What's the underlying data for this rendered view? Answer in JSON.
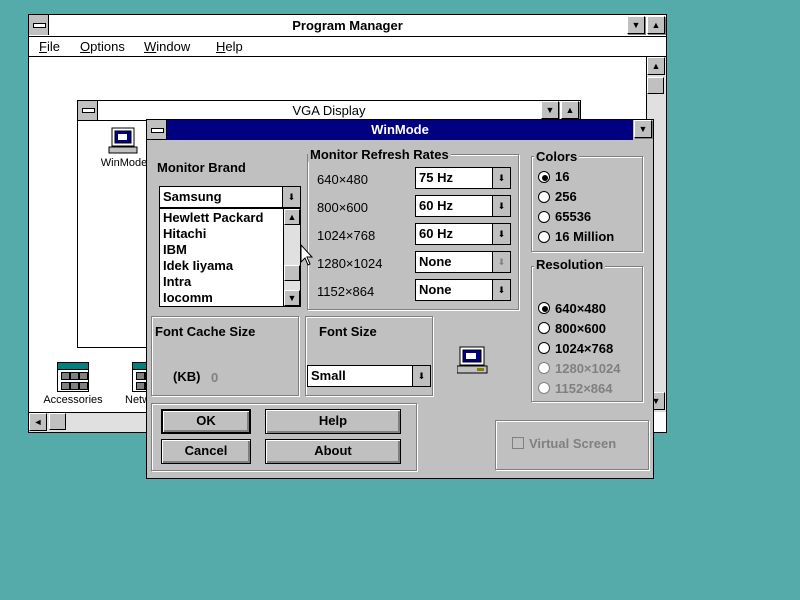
{
  "program_manager": {
    "title": "Program Manager",
    "menu": [
      "File",
      "Options",
      "Window",
      "Help"
    ],
    "icons": [
      {
        "label": "Accessories"
      },
      {
        "label": "Netw"
      }
    ]
  },
  "vga_window": {
    "title": "VGA Display",
    "icons": [
      {
        "label": "WinMode"
      }
    ]
  },
  "dialog": {
    "title": "WinMode",
    "monitor_brand": {
      "label": "Monitor Brand",
      "selected": "Samsung",
      "list": [
        "Hewlett Packard",
        "Hitachi",
        "IBM",
        "Idek Iiyama",
        "Intra",
        "Iocomm"
      ]
    },
    "refresh": {
      "label": "Monitor Refresh Rates",
      "rows": [
        {
          "res": "640×480",
          "value": "75 Hz"
        },
        {
          "res": "800×600",
          "value": "60 Hz"
        },
        {
          "res": "1024×768",
          "value": "60 Hz"
        },
        {
          "res": "1280×1024",
          "value": "None"
        },
        {
          "res": "1152×864",
          "value": "None"
        }
      ]
    },
    "colors": {
      "label": "Colors",
      "options": [
        "16",
        "256",
        "65536",
        "16 Million"
      ],
      "selected": "16"
    },
    "resolution": {
      "label": "Resolution",
      "options": [
        "640×480",
        "800×600",
        "1024×768",
        "1280×1024",
        "1152×864"
      ],
      "selected": "640×480"
    },
    "font_cache": {
      "label": "Font Cache Size",
      "unit": "(KB)",
      "value": "0"
    },
    "font_size": {
      "label": "Font Size",
      "selected": "Small"
    },
    "buttons": {
      "ok": "OK",
      "help": "Help",
      "cancel": "Cancel",
      "about": "About"
    },
    "virtual_screen": "Virtual Screen"
  },
  "icons": {
    "arrow_down": "▼",
    "arrow_up": "▲",
    "arrow_left": "◄",
    "arrow_right": "►",
    "combo_arrow": "⬇"
  }
}
